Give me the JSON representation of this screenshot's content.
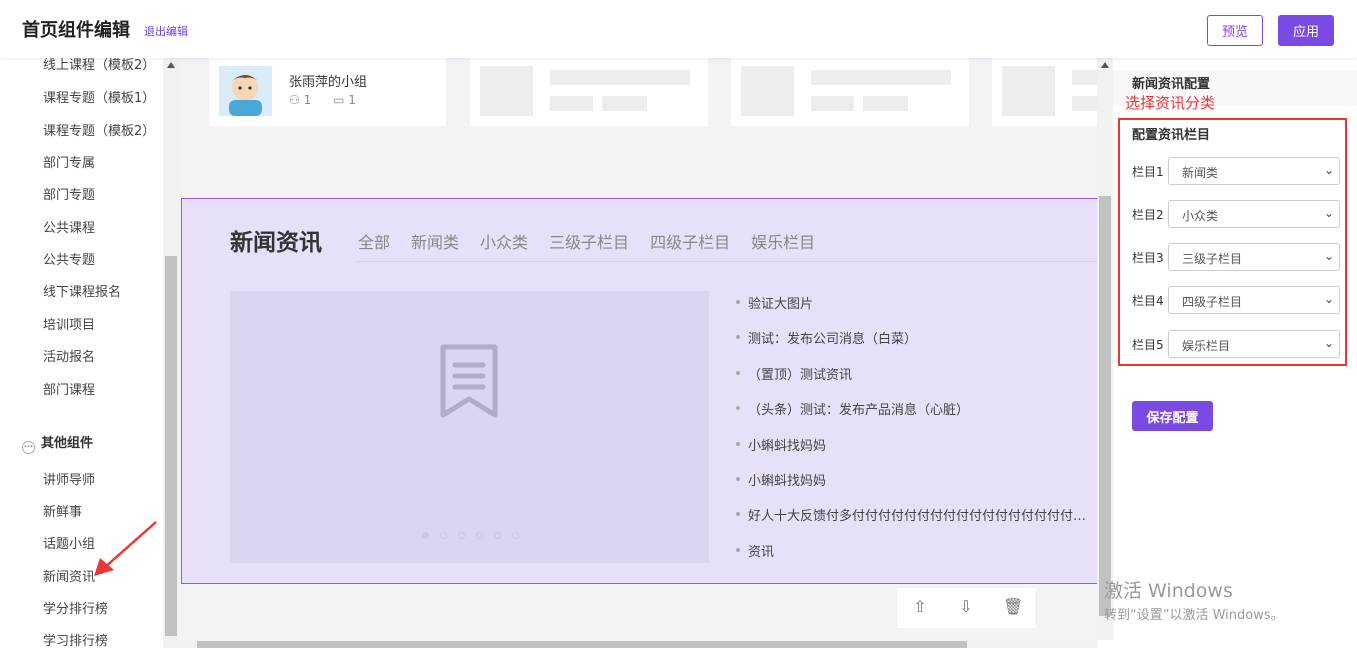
{
  "header": {
    "title": "首页组件编辑",
    "exit_label": "退出编辑",
    "preview_label": "预览",
    "apply_label": "应用"
  },
  "sidebar": {
    "items": [
      "线上课程（模板2）",
      "课程专题（模板1）",
      "课程专题（模板2）",
      "部门专属",
      "部门专题",
      "公共课程",
      "公共专题",
      "线下课程报名",
      "培训项目",
      "活动报名",
      "部门课程"
    ],
    "group_label": "其他组件",
    "other_items": [
      "讲师导师",
      "新鲜事",
      "话题小组",
      "新闻资讯",
      "学分排行榜",
      "学习排行榜"
    ]
  },
  "group_card": {
    "name": "张雨萍的小组",
    "members": "1",
    "posts": "1"
  },
  "news": {
    "title": "新闻资讯",
    "tabs": [
      "全部",
      "新闻类",
      "小众类",
      "三级子栏目",
      "四级子栏目",
      "娱乐栏目"
    ],
    "items": [
      "验证大图片",
      "测试：发布公司消息（白菜）",
      "（置顶）测试资讯",
      "（头条）测试：发布产品消息（心脏）",
      "小蝌蚪找妈妈",
      "小蝌蚪找妈妈",
      "好人十大反馈付多付付付付付付付付付付付付付付付付付付付",
      "资讯"
    ]
  },
  "panel": {
    "title": "新闻资讯配置",
    "annotation": "选择资讯分类",
    "config_title": "配置资讯栏目",
    "rows": [
      {
        "label": "栏目1",
        "value": "新闻类"
      },
      {
        "label": "栏目2",
        "value": "小众类"
      },
      {
        "label": "栏目3",
        "value": "三级子栏目"
      },
      {
        "label": "栏目4",
        "value": "四级子栏目"
      },
      {
        "label": "栏目5",
        "value": "娱乐栏目"
      }
    ],
    "save_label": "保存配置"
  },
  "watermark": {
    "line1": "激活 Windows",
    "line2": "转到“设置”以激活 Windows。"
  },
  "colors": {
    "accent": "#7b4ae2",
    "annotation": "#e63a3a",
    "news_bg": "#e8e0f9"
  }
}
